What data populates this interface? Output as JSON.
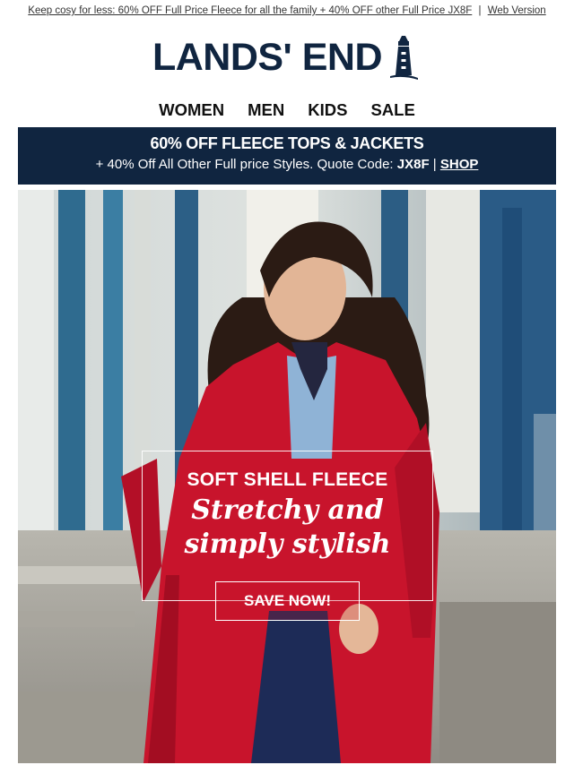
{
  "preheader": {
    "promo_text": "Keep cosy for less: 60% OFF Full Price Fleece for all the family + 40% OFF other Full Price JX8F",
    "separator": "|",
    "web_version": "Web Version"
  },
  "logo": {
    "text": "LANDS' END",
    "icon": "lighthouse-icon"
  },
  "nav": {
    "items": [
      "WOMEN",
      "MEN",
      "KIDS",
      "SALE"
    ]
  },
  "banner": {
    "headline": "60% OFF FLEECE TOPS & JACKETS",
    "subline": "+ 40% Off All Other Full price Styles. Quote Code:",
    "code": "JX8F",
    "separator": "|",
    "shop_label": "SHOP"
  },
  "hero": {
    "eyebrow": "SOFT SHELL FLEECE",
    "headline_line1": "Stretchy and",
    "headline_line2": "simply stylish",
    "cta_label": "SAVE NOW!"
  },
  "colors": {
    "navy": "#102540",
    "jacket_red": "#c8142c",
    "text": "#1b1b1b"
  }
}
